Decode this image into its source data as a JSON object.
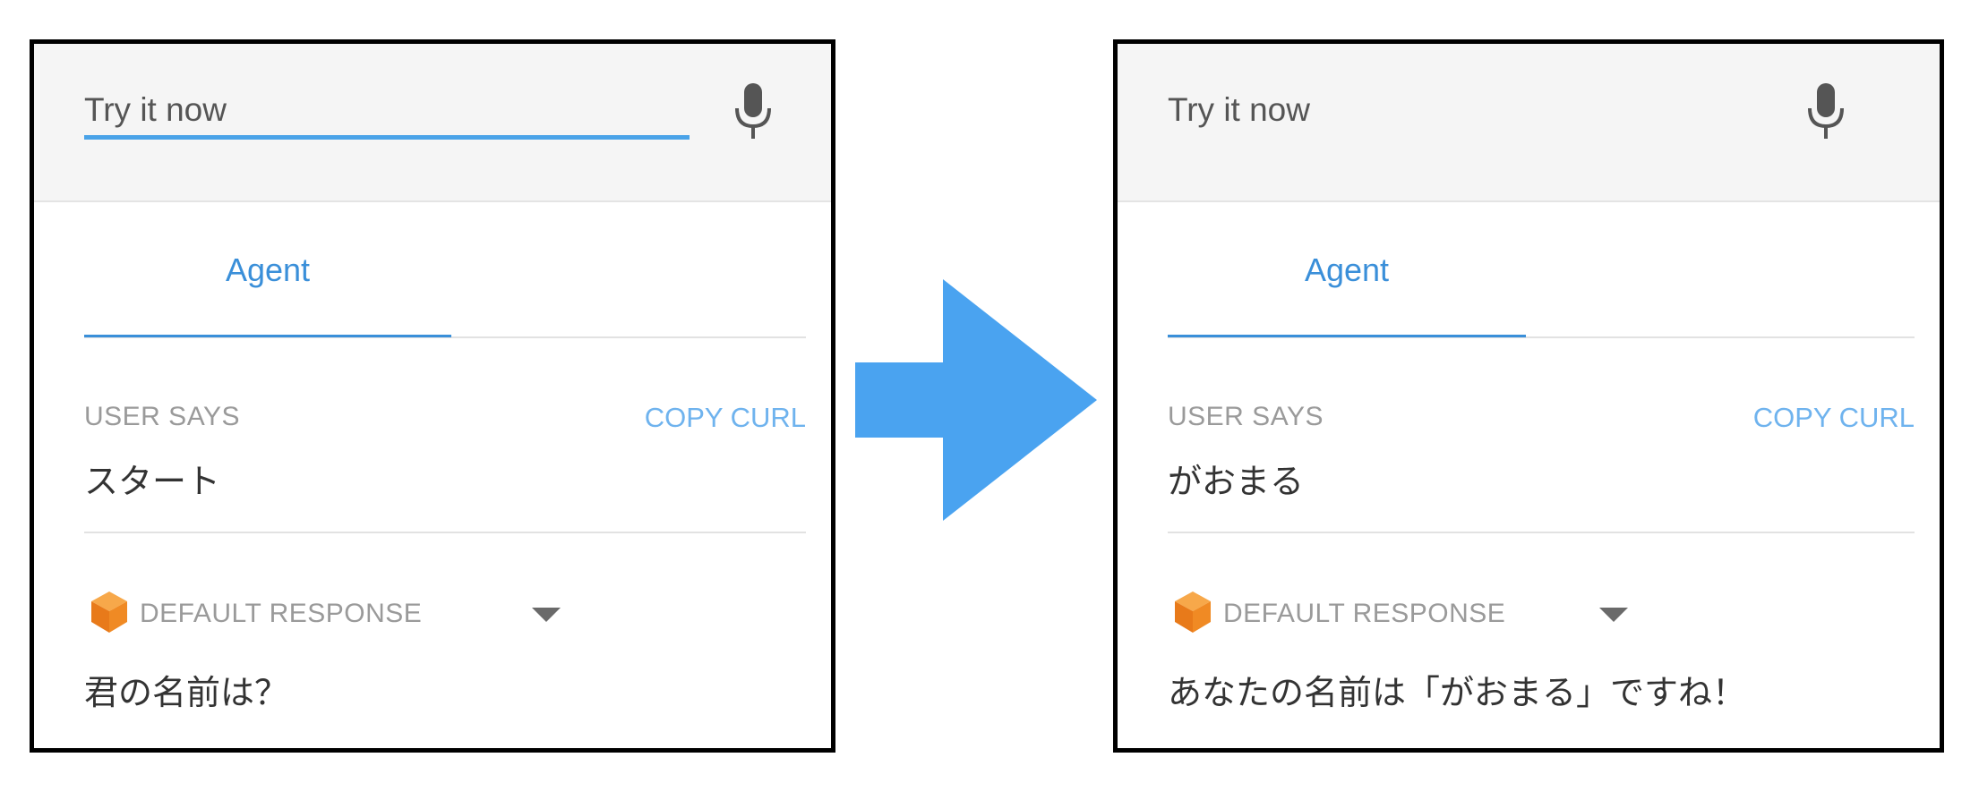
{
  "panels": [
    {
      "try_placeholder": "Try it now",
      "tab_label": "Agent",
      "user_says_label": "USER SAYS",
      "copy_curl_label": "COPY CURL",
      "user_text": "スタート",
      "response_label": "DEFAULT RESPONSE",
      "response_text": "君の名前は？"
    },
    {
      "try_placeholder": "Try it now",
      "tab_label": "Agent",
      "user_says_label": "USER SAYS",
      "copy_curl_label": "COPY CURL",
      "user_text": "がおまる",
      "response_label": "DEFAULT RESPONSE",
      "response_text": "あなたの名前は「がおまる」ですね！"
    }
  ],
  "icons": {
    "mic": "microphone-icon",
    "cube": "agent-cube-icon",
    "dropdown": "chevron-down-icon",
    "arrow": "right-arrow-icon"
  },
  "colors": {
    "accent": "#3a8fd9",
    "arrow": "#4aa3f0",
    "cube": "#f08a24"
  }
}
